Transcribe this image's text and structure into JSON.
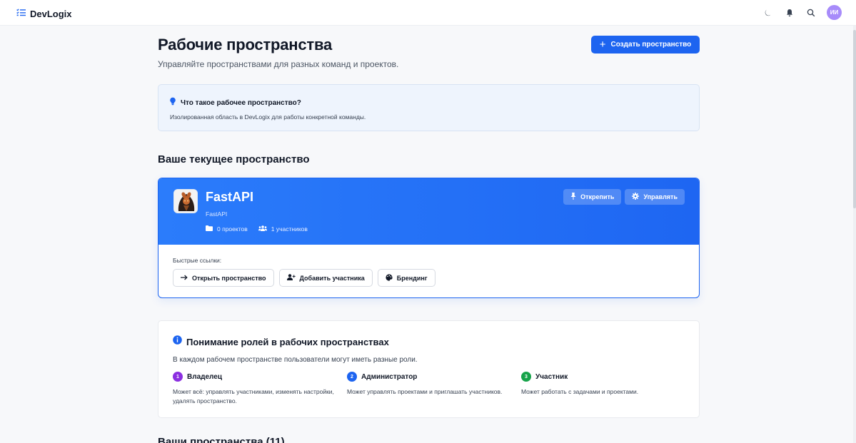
{
  "app": {
    "brand": "DevLogix",
    "avatar_initials": "ИИ",
    "accent": "#1d64f0"
  },
  "header": {
    "title": "Рабочие пространства",
    "subtitle": "Управляйте пространствами для разных команд и проектов.",
    "create_label": "Создать пространство"
  },
  "info": {
    "title": "Что такое рабочее пространство?",
    "text": "Изолированная область в DevLogix для работы конкретной команды."
  },
  "current": {
    "heading": "Ваше текущее пространство",
    "name": "FastAPI",
    "slug": "FastAPI",
    "projects": "0 проектов",
    "members": "1 участников",
    "unpin_label": "Открепить",
    "manage_label": "Управлять",
    "quick_label": "Быстрые ссылки:",
    "quick_links": {
      "open": "Открыть пространство",
      "add_member": "Добавить участника",
      "branding": "Брендинг"
    }
  },
  "roles": {
    "title": "Понимание ролей в рабочих пространствах",
    "description": "В каждом рабочем пространстве пользователи могут иметь разные роли.",
    "items": [
      {
        "num": "1",
        "name": "Владелец",
        "text": "Может всё: управлять участниками, изменять настройки, удалять пространство.",
        "color": "#8b2fe0"
      },
      {
        "num": "2",
        "name": "Администратор",
        "text": "Может управлять проектами и приглашать участников.",
        "color": "#1d64f0"
      },
      {
        "num": "3",
        "name": "Участник",
        "text": "Может работать с задачами и проектами.",
        "color": "#16a34a"
      }
    ]
  },
  "list": {
    "heading": "Ваши пространства (11)"
  }
}
